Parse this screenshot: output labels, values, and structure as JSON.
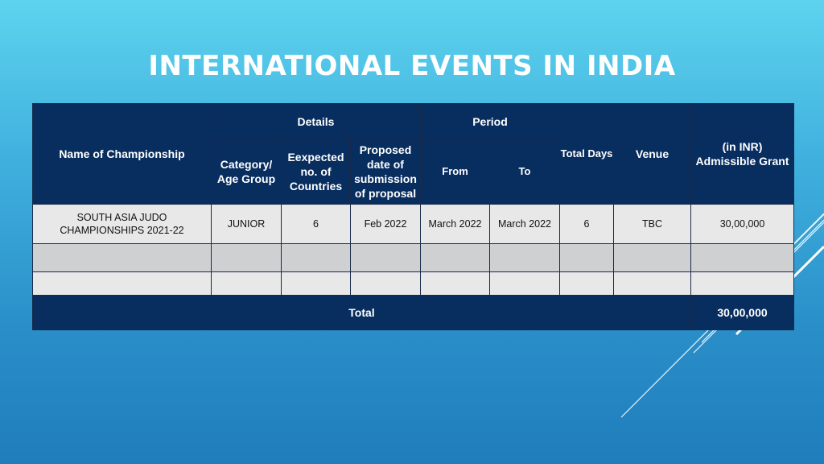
{
  "title": "INTERNATIONAL EVENTS IN INDIA",
  "colors": {
    "header_bg": "#082d5f",
    "row_light": "#e8e8e9",
    "row_dark": "#cfd0d2"
  },
  "table": {
    "headers": {
      "name": "Name of Championship",
      "details": "Details",
      "period": "Period",
      "category": "Category/ Age Group",
      "expected": "Eexpected no. of Countries",
      "proposed": "Proposed date of submission of proposal",
      "from": "From",
      "to": "To",
      "total_days": "Total Days",
      "venue": "Venue",
      "grant_unit": "(in INR)",
      "grant": "Admissible Grant"
    },
    "rows": [
      {
        "name": "SOUTH ASIA JUDO CHAMPIONSHIPS 2021-22",
        "category": "JUNIOR",
        "countries": "6",
        "proposed": "Feb 2022",
        "from": "March 2022",
        "to": "March 2022",
        "days": "6",
        "venue": "TBC",
        "grant": "30,00,000"
      }
    ],
    "total_label": "Total",
    "total_value": "30,00,000"
  }
}
